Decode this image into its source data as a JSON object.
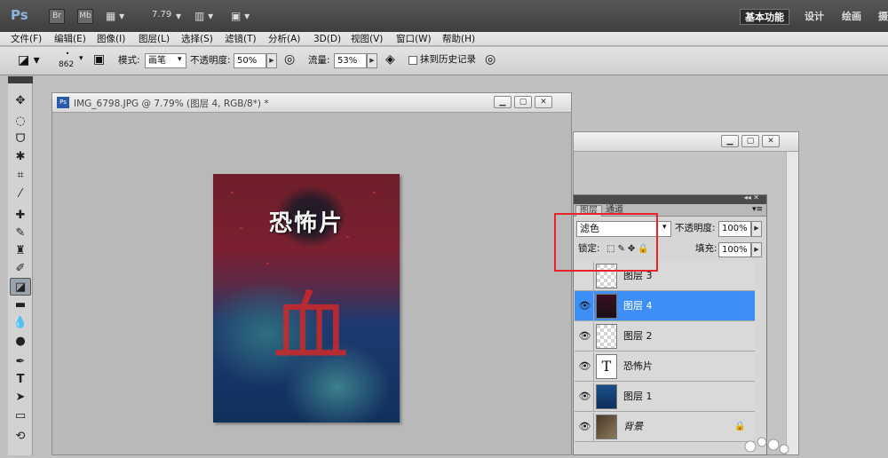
{
  "app": {
    "logo": "Ps",
    "bridge_btn": "Br",
    "minibridge_btn": "Mb",
    "zoom": "7.79",
    "workspaces": [
      {
        "label": "基本功能",
        "active": true
      },
      {
        "label": "设计",
        "active": false
      },
      {
        "label": "绘画",
        "active": false
      },
      {
        "label": "摄",
        "active": false
      }
    ]
  },
  "menus": [
    "文件(F)",
    "编辑(E)",
    "图像(I)",
    "图层(L)",
    "选择(S)",
    "滤镜(T)",
    "分析(A)",
    "3D(D)",
    "视图(V)",
    "窗口(W)",
    "帮助(H)"
  ],
  "options": {
    "brush_size": "862",
    "mode_label": "模式:",
    "mode_value": "画笔",
    "opacity_label": "不透明度:",
    "opacity_value": "50%",
    "flow_label": "流量:",
    "flow_value": "53%",
    "history_label": "抹到历史记录"
  },
  "document": {
    "title": "IMG_6798.JPG @ 7.79% (图层 4, RGB/8*) *",
    "canvas_title": "恐怖片",
    "canvas_glyph": "血"
  },
  "layers_panel": {
    "tabs": [
      "图层",
      "通道"
    ],
    "blend_mode": "滤色",
    "opacity_label": "不透明度:",
    "opacity_value": "100%",
    "lock_label": "锁定:",
    "fill_label": "填充:",
    "fill_value": "100%",
    "layers": [
      {
        "name": "图层 3",
        "visible": false,
        "selected": false
      },
      {
        "name": "图层 4",
        "visible": true,
        "selected": true
      },
      {
        "name": "图层 2",
        "visible": true,
        "selected": false
      },
      {
        "name": "恐怖片",
        "visible": true,
        "selected": false,
        "type": "text"
      },
      {
        "name": "图层 1",
        "visible": true,
        "selected": false
      },
      {
        "name": "背景",
        "visible": true,
        "selected": false,
        "locked": true
      }
    ]
  },
  "colors": {
    "highlight": "#e8232a",
    "selection": "#3d8ff5",
    "appbar": "#4a4a4a"
  }
}
